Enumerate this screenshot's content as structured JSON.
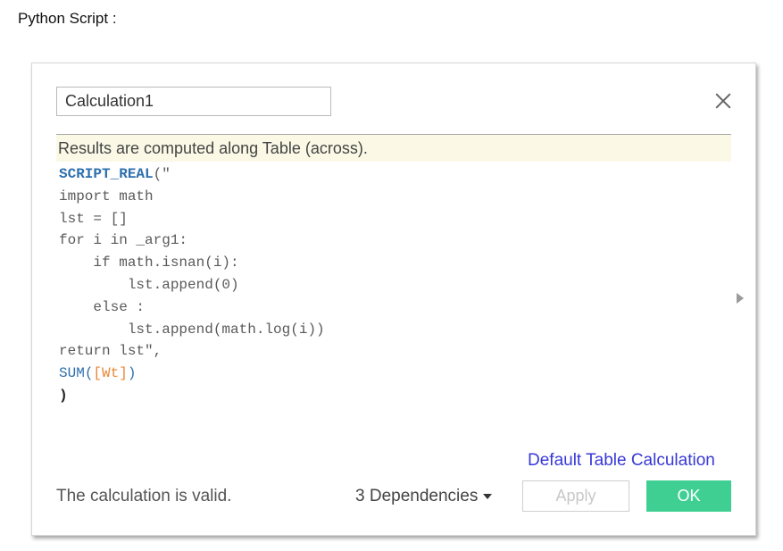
{
  "page": {
    "caption": "Python Script :"
  },
  "dialog": {
    "name_value": "Calculation1",
    "info_text": "Results are computed along Table (across).",
    "code": {
      "line1_func": "SCRIPT_REAL",
      "line1_rest": "(\"",
      "line2": "import math",
      "line3": "lst = []",
      "line4": "for i in _arg1:",
      "line5": "    if math.isnan(i):",
      "line6": "        lst.append(0)",
      "line7": "    else :",
      "line8": "        lst.append(math.log(i))",
      "line9": "return lst\",",
      "line10_func": "SUM",
      "line10_open": "(",
      "line10_field": "[Wt]",
      "line10_close": ")",
      "line11": ")"
    },
    "default_link": "Default Table Calculation",
    "status": "The calculation is valid.",
    "dependencies": "3 Dependencies",
    "apply_label": "Apply",
    "ok_label": "OK"
  },
  "icons": {
    "close": "close-icon",
    "expand": "expand-arrow-icon",
    "dropdown": "caret-down-icon"
  },
  "colors": {
    "ok_button": "#3fcf93",
    "info_bar": "#fbf9e6",
    "function_keyword": "#2e6fae",
    "field_reference": "#e8893a",
    "link": "#3838d6"
  }
}
